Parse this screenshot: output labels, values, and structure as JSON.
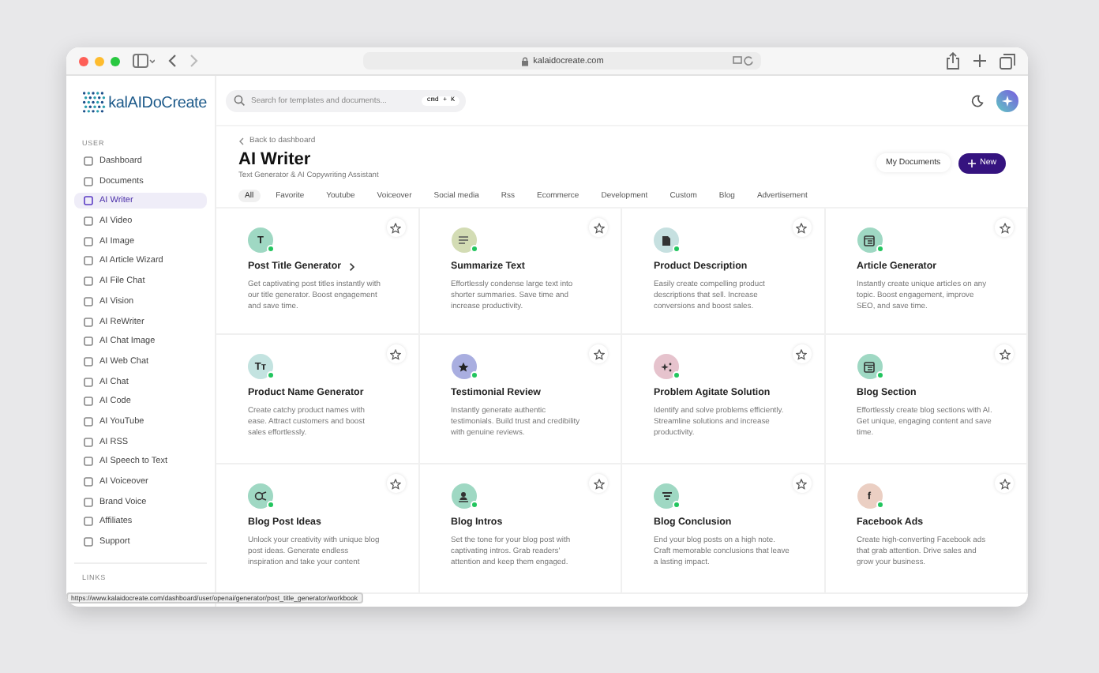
{
  "browser": {
    "url": "kalaidocreate.com"
  },
  "sidebar": {
    "logo": "kalAIDoCreate",
    "section": "USER",
    "items": [
      {
        "label": "Dashboard",
        "selected": false
      },
      {
        "label": "Documents",
        "selected": false
      },
      {
        "label": "AI Writer",
        "selected": true
      },
      {
        "label": "AI Video",
        "selected": false
      },
      {
        "label": "AI Image",
        "selected": false
      },
      {
        "label": "AI Article Wizard",
        "selected": false
      },
      {
        "label": "AI File Chat",
        "selected": false
      },
      {
        "label": "AI Vision",
        "selected": false
      },
      {
        "label": "AI ReWriter",
        "selected": false
      },
      {
        "label": "AI Chat Image",
        "selected": false
      },
      {
        "label": "AI Web Chat",
        "selected": false
      },
      {
        "label": "AI Chat",
        "selected": false
      },
      {
        "label": "AI Code",
        "selected": false
      },
      {
        "label": "AI YouTube",
        "selected": false
      },
      {
        "label": "AI RSS",
        "selected": false
      },
      {
        "label": "AI Speech to Text",
        "selected": false
      },
      {
        "label": "AI Voiceover",
        "selected": false
      },
      {
        "label": "Brand Voice",
        "selected": false
      },
      {
        "label": "Affiliates",
        "selected": false
      },
      {
        "label": "Support",
        "selected": false
      }
    ],
    "section_2": "LINKS"
  },
  "search": {
    "placeholder": "Search for templates and documents...",
    "shortcut": "cmd + K"
  },
  "page": {
    "back": "Back to dashboard",
    "title": "AI Writer",
    "subtitle": "Text Generator & AI Copywriting Assistant",
    "secondary_button": "My Documents",
    "primary_button": "New"
  },
  "tabs": [
    {
      "label": "All",
      "selected": true
    },
    {
      "label": "Favorite",
      "selected": false
    },
    {
      "label": "Youtube",
      "selected": false
    },
    {
      "label": "Voiceover",
      "selected": false
    },
    {
      "label": "Social media",
      "selected": false
    },
    {
      "label": "Rss",
      "selected": false
    },
    {
      "label": "Ecommerce",
      "selected": false
    },
    {
      "label": "Development",
      "selected": false
    },
    {
      "label": "Custom",
      "selected": false
    },
    {
      "label": "Blog",
      "selected": false
    },
    {
      "label": "Advertisement",
      "selected": false
    }
  ],
  "cards": [
    {
      "title": "Post Title Generator",
      "chevron": true,
      "kind": "letter",
      "icon_text": "T",
      "color": "#9fd8c3",
      "description": "Get captivating post titles instantly with our title generator. Boost engagement and save time."
    },
    {
      "title": "Summarize Text",
      "chevron": false,
      "kind": "lines",
      "color": "#d3dcb4",
      "description": "Effortlessly condense large text into shorter summaries. Save time and increase productivity."
    },
    {
      "title": "Product Description",
      "chevron": false,
      "kind": "document",
      "color": "#c6e0e0",
      "description": "Easily create compelling product descriptions that sell. Increase conversions and boost sales."
    },
    {
      "title": "Article Generator",
      "chevron": false,
      "kind": "window",
      "color": "#9fd8c3",
      "description": "Instantly create unique articles on any topic. Boost engagement, improve SEO, and save time."
    },
    {
      "title": "Product Name Generator",
      "chevron": false,
      "kind": "letter",
      "icon_text": "Tт",
      "color": "#c3e3e0",
      "description": "Create catchy product names with ease. Attract customers and boost sales effortlessly."
    },
    {
      "title": "Testimonial Review",
      "chevron": false,
      "kind": "star",
      "color": "#a9aee0",
      "description": "Instantly generate authentic testimonials. Build trust and credibility with genuine reviews."
    },
    {
      "title": "Problem Agitate Solution",
      "chevron": false,
      "kind": "sparkle",
      "color": "#e6c3cd",
      "description": "Identify and solve problems efficiently. Streamline solutions and increase productivity."
    },
    {
      "title": "Blog Section",
      "chevron": false,
      "kind": "window",
      "color": "#9fd8c3",
      "description": "Effortlessly create blog sections with AI. Get unique, engaging content and save time."
    },
    {
      "title": "Blog Post Ideas",
      "chevron": false,
      "kind": "bulb",
      "color": "#9fd8c3",
      "description": "Unlock your creativity with unique blog post ideas. Generate endless inspiration and take your content"
    },
    {
      "title": "Blog Intros",
      "chevron": false,
      "kind": "person",
      "color": "#9fd8c3",
      "description": "Set the tone for your blog post with captivating intros. Grab readers' attention and keep them engaged."
    },
    {
      "title": "Blog Conclusion",
      "chevron": false,
      "kind": "filter",
      "color": "#9fd8c3",
      "description": "End your blog posts on a high note. Craft memorable conclusions that leave a lasting impact."
    },
    {
      "title": "Facebook Ads",
      "chevron": false,
      "kind": "letter",
      "icon_text": "f",
      "color": "#ebcfc3",
      "description": "Create high-converting Facebook ads that grab attention. Drive sales and grow your business."
    }
  ],
  "status_bar": "https://www.kalaidocreate.com/dashboard/user/openai/generator/post_title_generator/workbook"
}
